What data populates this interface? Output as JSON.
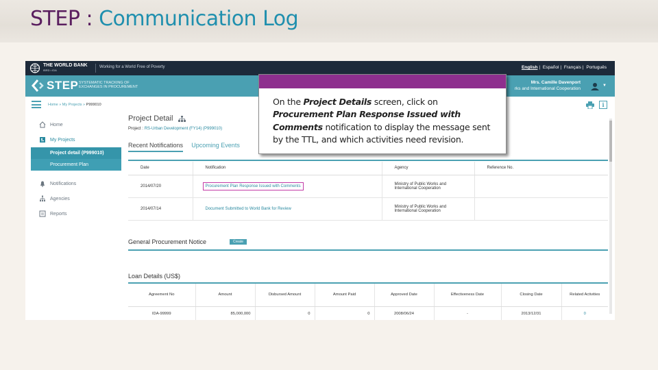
{
  "slide": {
    "title_prefix": "STEP",
    "title_sep": " : ",
    "title_main": "Communication Log"
  },
  "colors": {
    "accent_teal": "#4aa0b2",
    "wb_navy": "#1d2a3a",
    "callout_purple": "#8e2f8e",
    "highlight_magenta": "#c23aa6",
    "title_plum": "#5a1e5f",
    "title_blue": "#1f8fae"
  },
  "wb_header": {
    "brand": "THE WORLD BANK",
    "brand_sub": "IBRD • IDA",
    "tagline": "Working for a World Free of Poverty",
    "languages": [
      "English",
      "Español",
      "Français",
      "Português"
    ],
    "active_language": "English"
  },
  "step_header": {
    "logo_text": "STEP",
    "desc_line1": "SYSTEMATIC TRACKING OF",
    "desc_line2": "EXCHANGES IN PROCUREMENT",
    "user_name": "Mrs. Camille Davenport",
    "user_org": "rks and International Cooperation",
    "avatar_icon": "user-icon"
  },
  "breadcrumb": {
    "home": "Home",
    "sep": " » ",
    "my_projects": "My Projects",
    "current": "P999010"
  },
  "sidebar": {
    "items": [
      {
        "label": "Home",
        "icon": "home-icon"
      },
      {
        "label": "My Projects",
        "icon": "projects-icon"
      }
    ],
    "sub_items": [
      "Project detail (P999010)",
      "Procurement Plan"
    ],
    "items_after": [
      {
        "label": "Notifications",
        "icon": "bell-icon"
      },
      {
        "label": "Agencies",
        "icon": "org-icon"
      },
      {
        "label": "Reports",
        "icon": "report-icon"
      }
    ]
  },
  "project": {
    "title": "Project Detail",
    "line_label": "Project : ",
    "line_value": "RS-Urban Development (FY14) (P999010)"
  },
  "tabs": [
    "Recent Notifications",
    "Upcoming Events"
  ],
  "notifications": {
    "headers": [
      "Date",
      "Notification",
      "Agency",
      "Reference No."
    ],
    "rows": [
      {
        "date": "2014/07/20",
        "notification": "Procurement Plan Response Issued with Comments",
        "agency_line1": "Ministry of Public Works and",
        "agency_line2": "International Cooperation",
        "ref": ""
      },
      {
        "date": "2014/07/14",
        "notification": "Document Submitted to World Bank for Review",
        "agency_line1": "Ministry of Public Works and",
        "agency_line2": "International Cooperation",
        "ref": ""
      }
    ]
  },
  "gpn": {
    "title": "General Procurement Notice",
    "create_label": "Create"
  },
  "loan": {
    "title": "Loan Details (US$)",
    "headers": [
      "Agreement No",
      "Amount",
      "Disbursed Amount",
      "Amount Paid",
      "Approved Date",
      "Effectiveness Date",
      "Closing Date",
      "Related Activities"
    ],
    "row": [
      "IDA-99999",
      "85,000,000",
      "0",
      "0",
      "2008/06/24",
      "-",
      "2013/12/31",
      "0"
    ]
  },
  "callout": {
    "p1": "On the ",
    "b1": "Project Details",
    "p2": " screen, click on ",
    "b2": "Procurement Plan Response Issued with Comments",
    "p3": " notification to display the message sent by the TTL, and which activities need revision."
  }
}
